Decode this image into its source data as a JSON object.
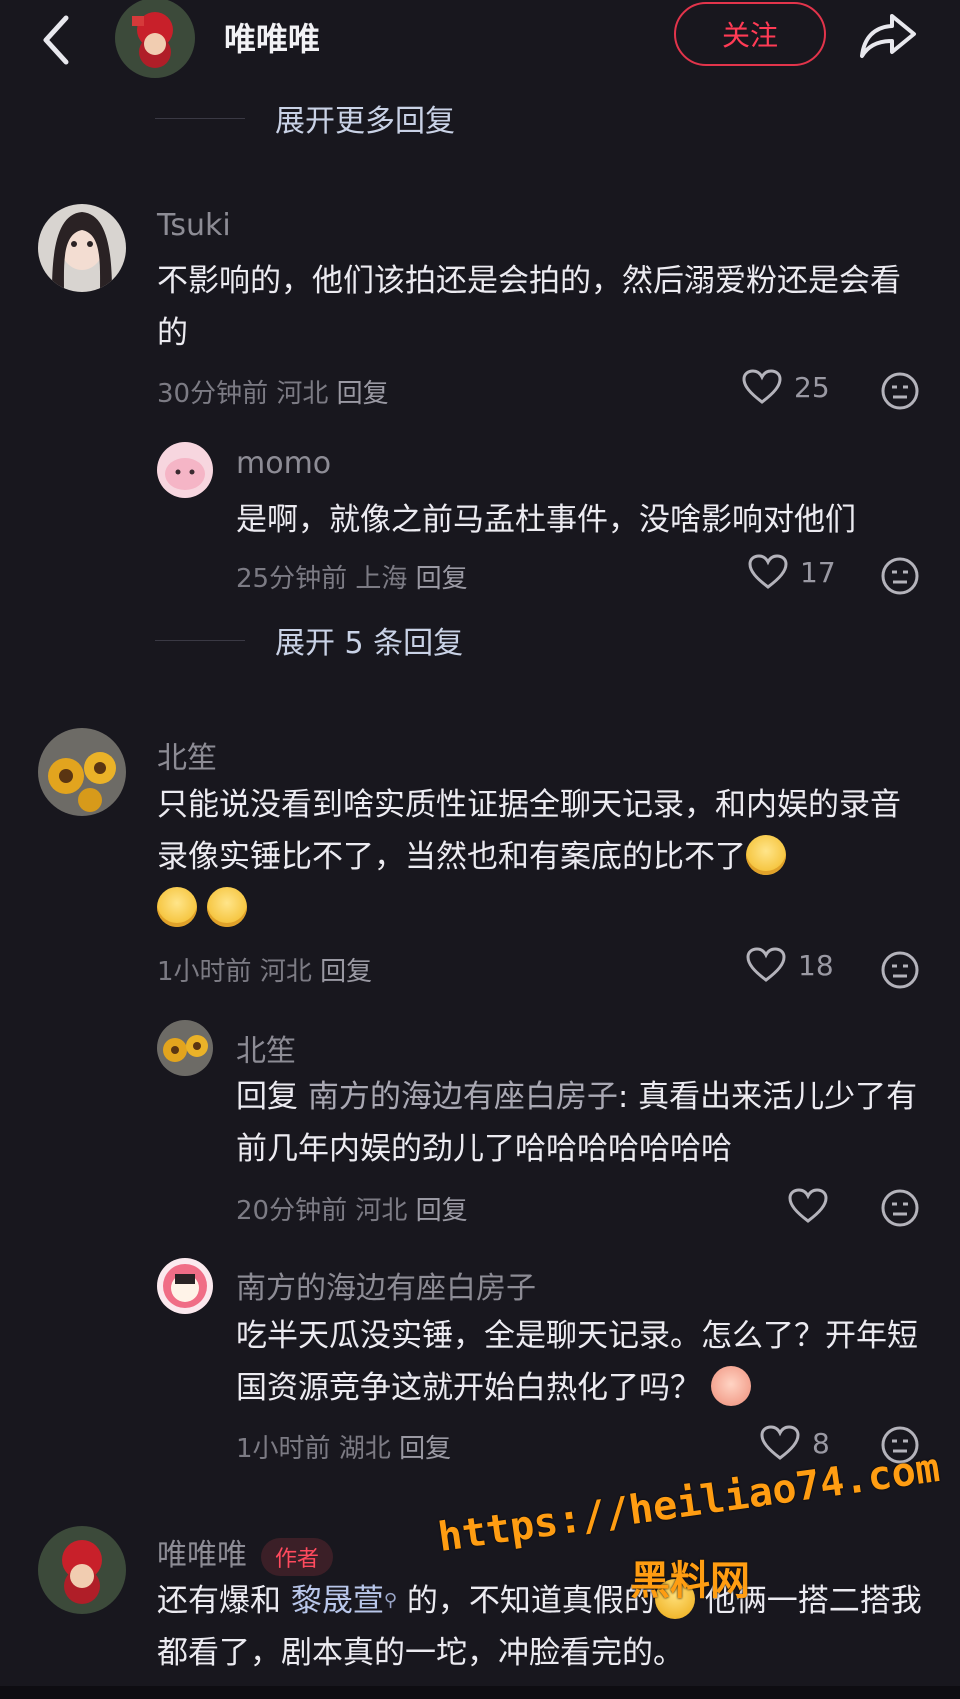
{
  "header": {
    "title": "唯唯唯",
    "follow_label": "关注"
  },
  "expand_top": "展开更多回复",
  "comments": [
    {
      "username": "Tsuki",
      "text": "不影响的，他们该拍还是会拍的，然后溺爱粉还是会看的",
      "time": "30分钟前",
      "location": "河北",
      "reply_label": "回复",
      "likes": "25",
      "replies": [
        {
          "username": "momo",
          "text": "是啊，就像之前马孟杜事件，没啥影响对他们",
          "time": "25分钟前",
          "location": "上海",
          "reply_label": "回复",
          "likes": "17"
        }
      ],
      "expand_label": "展开 5 条回复"
    },
    {
      "username": "北笙",
      "text": "只能说没看到啥实质性证据全聊天记录，和内娱的录音录像实锤比不了，当然也和有案底的比不了",
      "time": "1小时前",
      "location": "河北",
      "reply_label": "回复",
      "likes": "18",
      "replies": [
        {
          "username": "北笙",
          "reply_prefix": "回复",
          "reply_to": "南方的海边有座白房子",
          "text": ": 真看出来活儿少了有前几年内娱的劲儿了哈哈哈哈哈哈哈",
          "time": "20分钟前",
          "location": "河北",
          "reply_label": "回复",
          "likes": ""
        },
        {
          "username": "南方的海边有座白房子",
          "text": "吃半天瓜没实锤，全是聊天记录。怎么了？开年短国资源竞争这就开始白热化了吗？",
          "time": "1小时前",
          "location": "湖北",
          "reply_label": "回复",
          "likes": "8"
        }
      ]
    },
    {
      "username": "唯唯唯",
      "badge": "作者",
      "text_a": "还有爆和 ",
      "mention": "黎晟萱",
      "text_b": " 的，不知道真假的",
      "text_c": " 他俩一搭二搭我都看了，剧本真的一坨，冲脸看完的。"
    }
  ],
  "watermark": {
    "url": "https://heiliao74.com",
    "name": "黑料网"
  },
  "colors": {
    "background": "#18171e",
    "accent": "#ff3b55",
    "watermark": "#ff9d12"
  },
  "icons": [
    "back-arrow-icon",
    "share-icon",
    "heart-icon",
    "dislike-face-icon",
    "lemon-emoji",
    "peach-emoji",
    "thinking-emoji",
    "mention-icon"
  ]
}
